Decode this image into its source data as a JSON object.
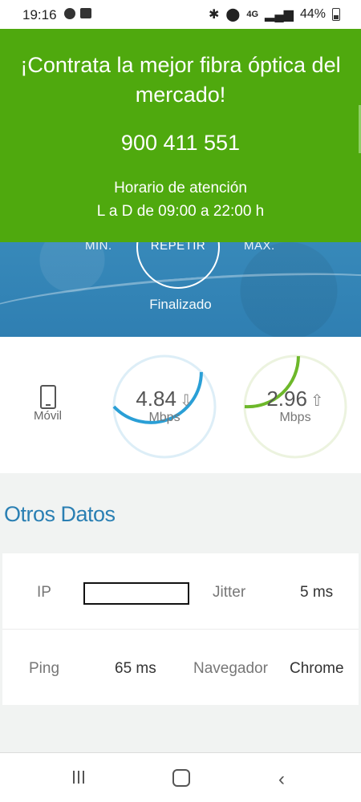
{
  "status_bar": {
    "time": "19:16",
    "network": "4G",
    "battery": "44%",
    "icons": [
      "whatsapp-icon",
      "image-icon",
      "bluetooth-icon",
      "location-icon",
      "signal-icon",
      "battery-icon"
    ]
  },
  "promo": {
    "title": "¡Contrata la mejor fibra óptica del mercado!",
    "phone": "900 411 551",
    "hours_line1": "Horario de atención",
    "hours_line2": "L a D de 09:00 a 22:00 h",
    "bg_color": "#4fa90e"
  },
  "test": {
    "min_label": "MIN.",
    "repeat_label": "REPETIR",
    "max_label": "MAX.",
    "status": "Finalizado"
  },
  "results": {
    "device_label": "Móvil",
    "download": {
      "value": "4.84",
      "unit": "Mbps",
      "arrow": "⇩",
      "color": "#2a9fd6",
      "fill": 0.38
    },
    "upload": {
      "value": "2.96",
      "unit": "Mbps",
      "arrow": "⇧",
      "color": "#6db82a",
      "fill": 0.26
    }
  },
  "otros_datos": {
    "title": "Otros Datos",
    "rows": [
      {
        "label1": "IP",
        "value1": "",
        "label2": "Jitter",
        "value2": "5 ms"
      },
      {
        "label1": "Ping",
        "value1": "65 ms",
        "label2": "Navegador",
        "value2": "Chrome"
      }
    ]
  },
  "nav": {
    "icons": [
      "recents-icon",
      "home-icon",
      "back-icon"
    ],
    "back_glyph": "‹"
  }
}
